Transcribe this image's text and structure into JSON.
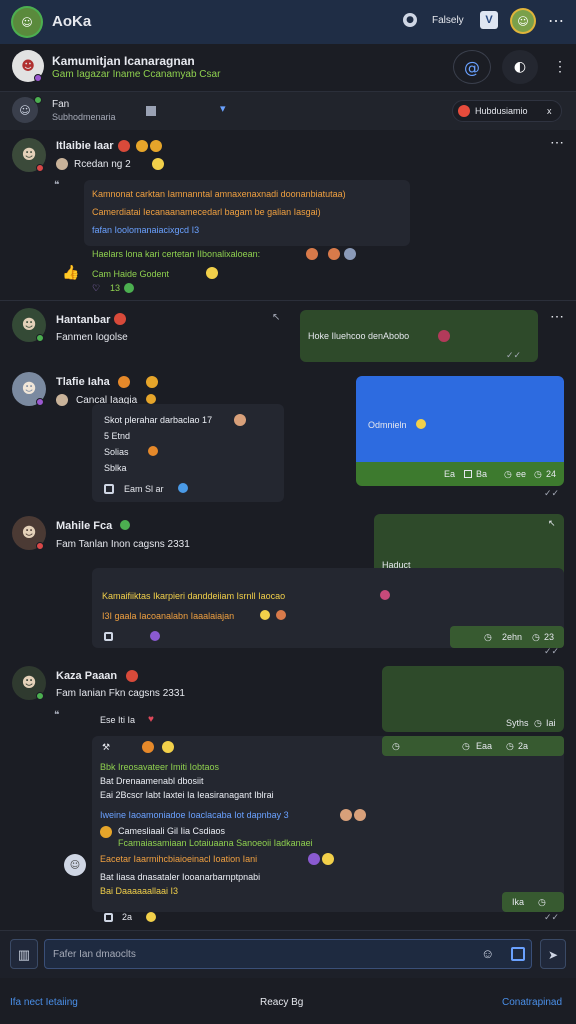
{
  "topbar": {
    "app_name": "AoKa",
    "nav_label": "Falsely",
    "status_icon": "info-circle-icon",
    "badge_icon": "v-badge-icon"
  },
  "chat_header": {
    "title": "Kamumitjan Icanaragnan",
    "subtitle": "Gam Iagazar Iname Ccanamyab Csar",
    "action_icons": [
      "at-sign-icon",
      "chat-bubble-icon",
      "more-icon"
    ]
  },
  "subheader": {
    "name": "Fan",
    "caption": "Subhodmenaria",
    "chip_label": "Hubdusiamio",
    "chip_close": "x"
  },
  "messages": [
    {
      "author": "Itlaibie Iaar",
      "meta": "Rcedan ng 2",
      "body_lines": [
        {
          "text": "Kamnonat carktan Iamnanntal amnaxenaxnadi doonanbiatutaa)",
          "color": "orange"
        },
        {
          "text": "Camerdiatai Iecanaanamecedarl bagam be galian Iasgai)",
          "color": "orange"
        },
        {
          "text": "fafan Ioolomanaiacixgcd I3",
          "color": "blue"
        },
        {
          "text": "Haelars lona kari certetan IIbonalixaloean:",
          "color": "green"
        },
        {
          "text": "Cam Haide Godent",
          "color": "green"
        }
      ],
      "reactions": "13"
    },
    {
      "author": "Hantanbar",
      "meta": "Fanmen Iogolse",
      "reply_text": "Hoke Iluehcoo denAbobo"
    },
    {
      "author": "Tlafie Iaha",
      "meta": "Cancal Iaagia",
      "body_lines": [
        {
          "text": "Skot plerahar darbaclao 17",
          "color": "white"
        },
        {
          "text": "5 Etnd",
          "color": "white"
        },
        {
          "text": "Solias",
          "color": "white"
        },
        {
          "text": "Sblka",
          "color": "white"
        }
      ],
      "footer": "Eam Sl ar",
      "blue_card_text": "Odmnieln",
      "blue_card_meta": [
        "Ea",
        "Iac",
        "Ba",
        "ee",
        "24"
      ]
    },
    {
      "author": "Mahile Fca",
      "meta": "Fam Tanlan Inon cagsns 2331",
      "green_card_text": "Haduct",
      "body_lines": [
        {
          "text": "Kamaifiiktas Ikarpieri danddeiiam Isrnll Iaocao",
          "color": "yellow"
        },
        {
          "text": "I3I gaala Iacoanalabn Iaaalaiajan",
          "color": "orange"
        }
      ],
      "stat_strip": [
        "2ehn",
        "23"
      ]
    },
    {
      "author": "Kaza Paaan",
      "meta": "Fam Ianian Fkn cagsns 2331",
      "green_card_meta": [
        "Syths",
        "Iai"
      ],
      "heart_text": "Ese Iti Ia",
      "thread_lines": [
        {
          "text": "Bbk Ireosavateer Imiti Iobtaos",
          "color": "green"
        },
        {
          "text": "Bat Drenaamenabl dbosiit",
          "color": "white"
        },
        {
          "text": "Eai 2Bcscr Iabt Iaxtei Ia Ieasiranagant Iblrai",
          "color": "white"
        },
        {
          "text": "Iweine Iaoamoniadoe Ioaclacaba Iot dapnbay 3",
          "color": "blue"
        },
        {
          "text": "Camesliaali Gil Iia Csdiaos",
          "color": "white"
        },
        {
          "text": "Fcamaiasamiaan Lotaiuaana Sanoeoii Iadkanaei",
          "color": "green"
        },
        {
          "text": "Eacetar Iaarmihcbiaioeinacl Ioation Iani",
          "color": "orange"
        },
        {
          "text": "Bat Iiasa dnasataler Iooanarbarnptpnabi",
          "color": "white"
        },
        {
          "text": "Bai Daaaaaallaai I3",
          "color": "yellow"
        }
      ],
      "thread_meta": [
        "Eaa",
        "ag",
        "Eaa",
        "2a"
      ],
      "end_meta": "Ika"
    }
  ],
  "composer": {
    "placeholder": "Fafer Ian dmaoclts"
  },
  "footer": {
    "left_link": "Ifa nect Ietaiing",
    "center": "Reacy Bg",
    "right_link": "Conatrapinad"
  }
}
